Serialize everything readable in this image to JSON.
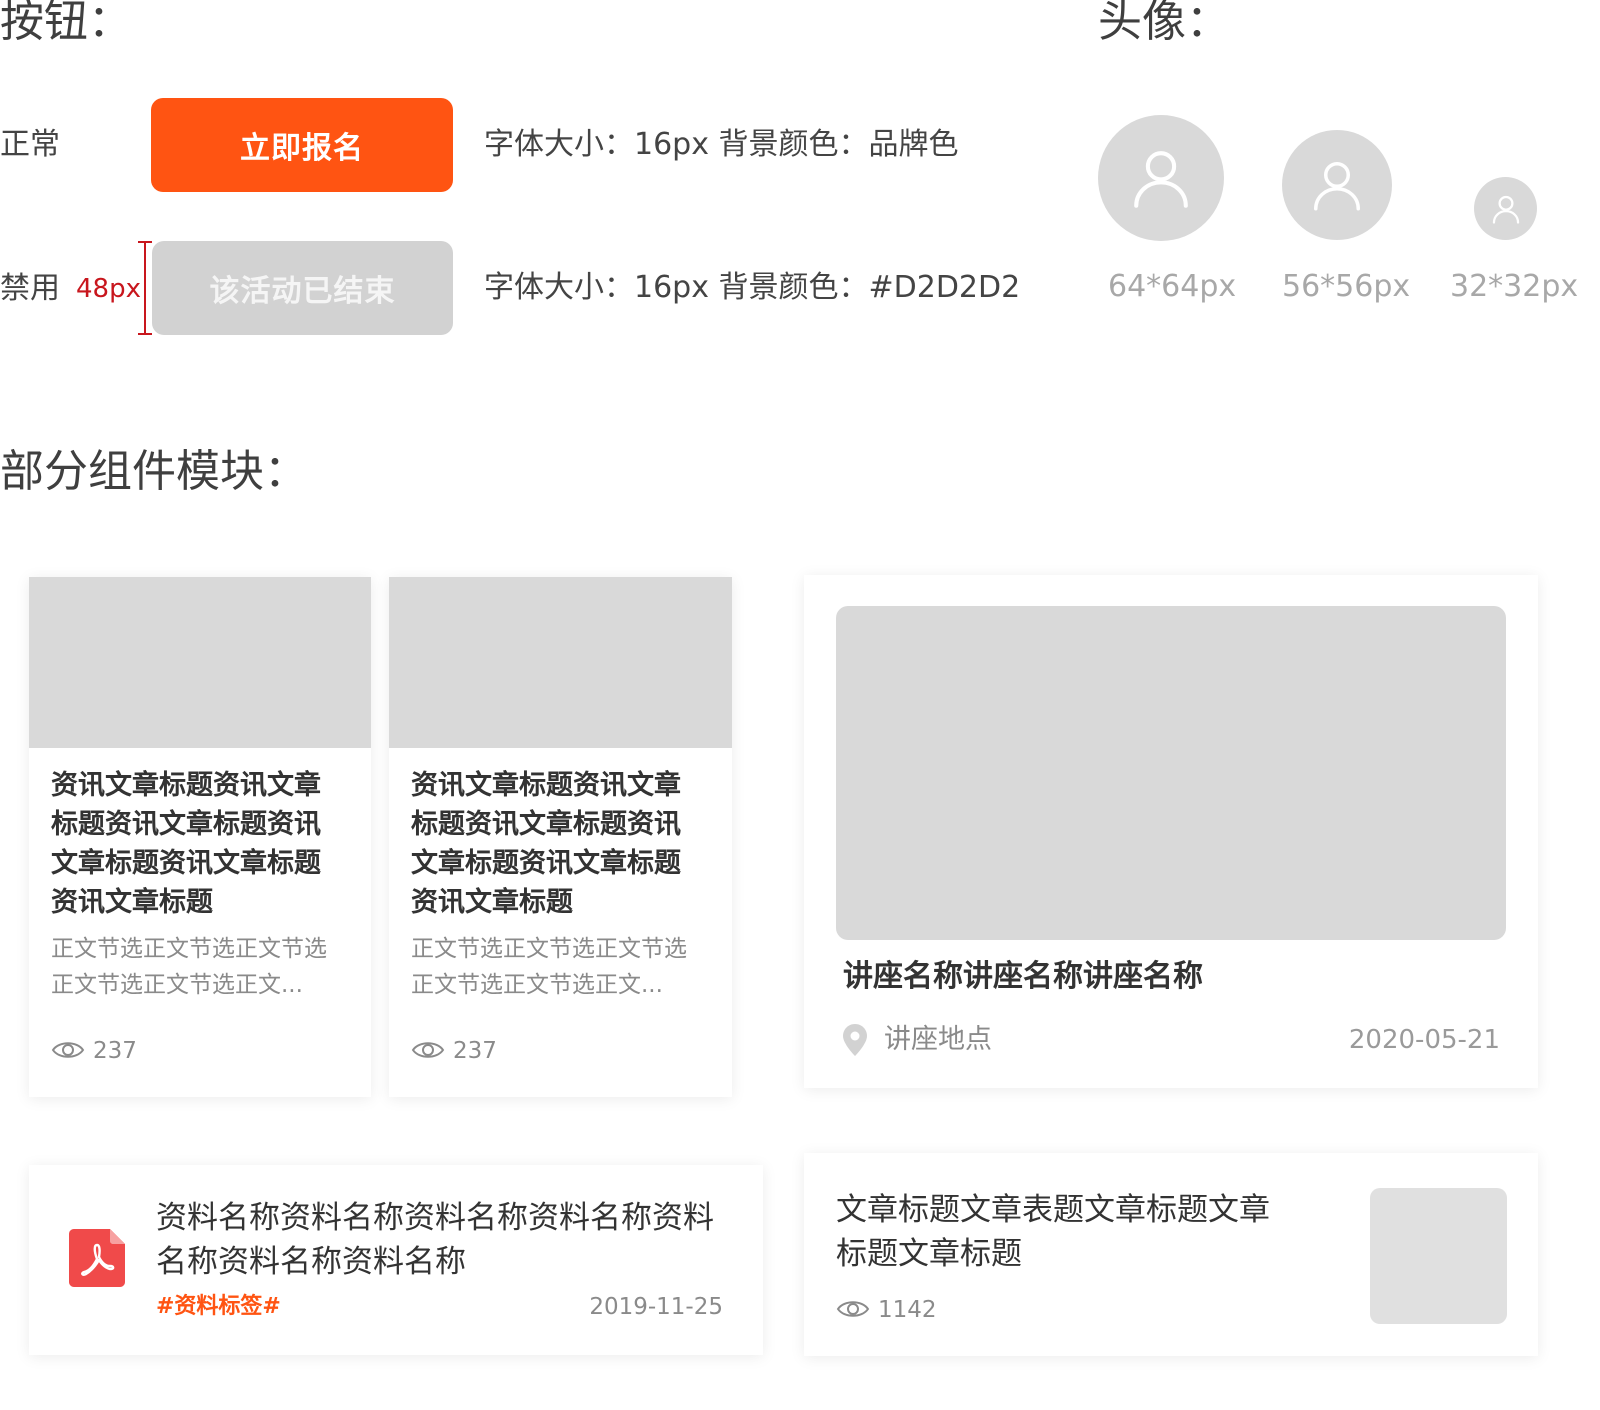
{
  "colors": {
    "brand": "#FF5412",
    "disabled_bg": "#D2D2D2",
    "placeholder": "#D9D9D9",
    "measure": "#C8161D"
  },
  "buttons_section": {
    "title": "按钮：",
    "rows": [
      {
        "label": "正常",
        "button_label": "立即报名",
        "description": "字体大小：16px  背景颜色：品牌色"
      },
      {
        "label": "禁用",
        "measure": "48px",
        "button_label": "该活动已结束",
        "description": "字体大小：16px  背景颜色：#D2D2D2"
      }
    ]
  },
  "avatars_section": {
    "title": "头像：",
    "avatars": [
      {
        "icon": "user-icon",
        "label": "64*64px"
      },
      {
        "icon": "user-icon",
        "label": "56*56px"
      },
      {
        "icon": "user-icon",
        "label": "32*32px"
      }
    ]
  },
  "components_section": {
    "title": "部分组件模块：",
    "news_cards": [
      {
        "title": "资讯文章标题资讯文章标题资讯文章标题资讯文章标题资讯文章标题资讯文章标题",
        "excerpt": "正文节选正文节选正文节选正文节选正文节选正文...",
        "views": "237"
      },
      {
        "title": "资讯文章标题资讯文章标题资讯文章标题资讯文章标题资讯文章标题资讯文章标题",
        "excerpt": "正文节选正文节选正文节选正文节选正文节选正文...",
        "views": "237"
      }
    ],
    "lecture_card": {
      "title": "讲座名称讲座名称讲座名称",
      "location": "讲座地点",
      "date": "2020-05-21"
    },
    "document_card": {
      "icon": "pdf-icon",
      "title": "资料名称资料名称资料名称资料名称资料名称资料名称资料名称",
      "tag": "#资料标签#",
      "date": "2019-11-25"
    },
    "article_card": {
      "title": "文章标题文章表题文章标题文章标题文章标题",
      "views": "1142"
    }
  }
}
